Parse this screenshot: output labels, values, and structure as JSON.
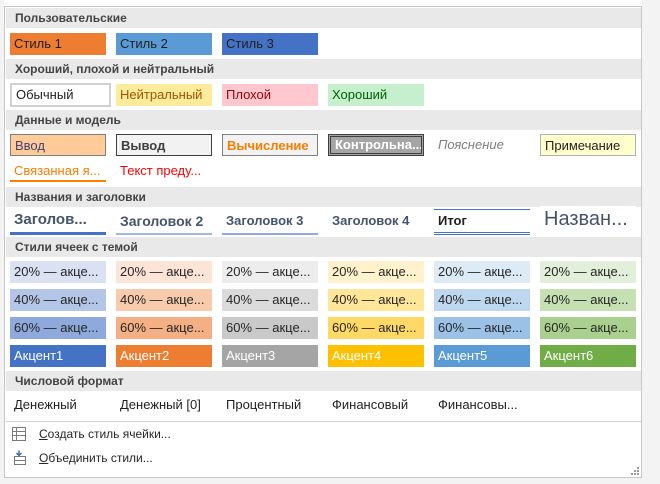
{
  "sections": {
    "custom": "Пользовательские",
    "good_bad": "Хороший, плохой и нейтральный",
    "data_model": "Данные и модель",
    "titles": "Названия и заголовки",
    "themed": "Стили ячеек с темой",
    "number": "Числовой формат"
  },
  "custom_styles": [
    "Стиль 1",
    "Стиль 2",
    "Стиль 3"
  ],
  "good_bad_styles": [
    "Обычный",
    "Нейтральный",
    "Плохой",
    "Хороший"
  ],
  "data_model_styles": [
    "Ввод",
    "Вывод",
    "Вычисление",
    "Контрольна...",
    "Пояснение",
    "Примечание",
    "Связанная я...",
    "Текст преду..."
  ],
  "title_styles": [
    "Заголов...",
    "Заголовок 2",
    "Заголовок 3",
    "Заголовок 4",
    "Итог",
    "Назван..."
  ],
  "themed_rows": {
    "row20": [
      "20% — акце...",
      "20% — акце...",
      "20% — акце...",
      "20% — акце...",
      "20% — акце...",
      "20% — акце..."
    ],
    "row40": [
      "40% — акце...",
      "40% — акце...",
      "40% — акце...",
      "40% — акце...",
      "40% — акце...",
      "40% — акце..."
    ],
    "row60": [
      "60% — акце...",
      "60% — акце...",
      "60% — акце...",
      "60% — акце...",
      "60% — акце...",
      "60% — акце..."
    ],
    "accents": [
      "Акцент1",
      "Акцент2",
      "Акцент3",
      "Акцент4",
      "Акцент5",
      "Акцент6"
    ]
  },
  "number_styles": [
    "Денежный",
    "Денежный [0]",
    "Процентный",
    "Финансовый",
    "Финансовы..."
  ],
  "footer": {
    "create_prefix": "С",
    "create_rest": "оздать стиль ячейки...",
    "merge_prefix": "О",
    "merge_rest": "бъединить стили..."
  },
  "colors": {
    "accent1": "#4472c4",
    "accent2": "#ed7d31",
    "accent3": "#a5a5a5",
    "accent4": "#ffc000",
    "accent5": "#5b9bd5",
    "accent6": "#70ad47",
    "custom1": "#ed7d31",
    "custom2": "#5b9bd5",
    "custom3": "#4472c4",
    "neutral_bg": "#ffeb9c",
    "neutral_fg": "#9c5700",
    "bad_bg": "#ffc7ce",
    "bad_fg": "#9c0006",
    "good_bg": "#c6efce",
    "good_fg": "#006100"
  }
}
